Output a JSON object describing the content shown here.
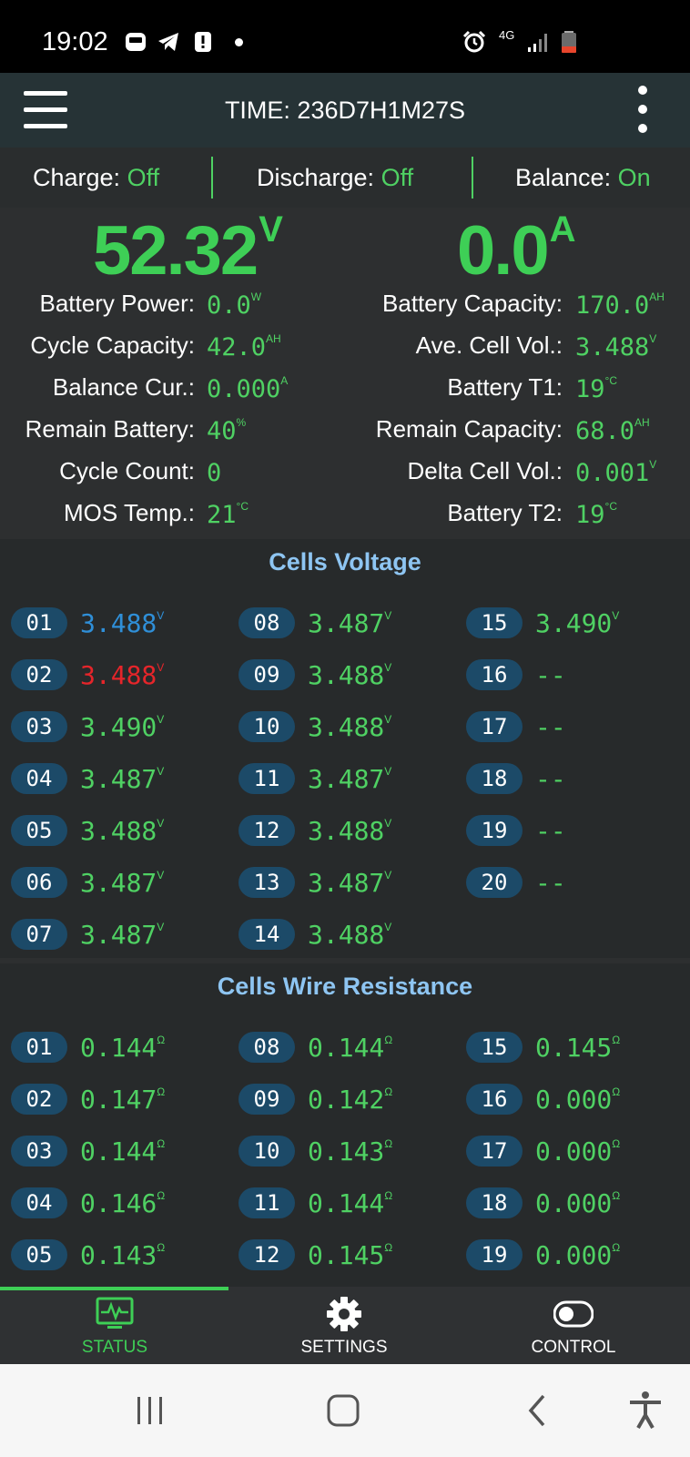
{
  "status_bar": {
    "time": "19:02",
    "network": "4G",
    "icons": [
      "adblocker-icon",
      "telegram-icon",
      "alert-icon",
      "alarm-icon",
      "signal-icon",
      "battery-icon"
    ]
  },
  "app_bar": {
    "title": "TIME: 236D7H1M27S"
  },
  "switches": {
    "charge_label": "Charge: ",
    "charge_value": "Off",
    "discharge_label": "Discharge: ",
    "discharge_value": "Off",
    "balance_label": "Balance: ",
    "balance_value": "On"
  },
  "main": {
    "voltage": "52.32",
    "voltage_unit": "V",
    "current": "0.0",
    "current_unit": "A"
  },
  "info_left": [
    {
      "label": "Battery Power:",
      "value": "0.0",
      "unit": "W"
    },
    {
      "label": "Cycle Capacity:",
      "value": "42.0",
      "unit": "AH"
    },
    {
      "label": "Balance Cur.:",
      "value": "0.000",
      "unit": "A"
    },
    {
      "label": "Remain Battery:",
      "value": "40",
      "unit": "%"
    },
    {
      "label": "Cycle Count:",
      "value": "0",
      "unit": ""
    },
    {
      "label": "MOS Temp.:",
      "value": "21",
      "unit": "°C"
    }
  ],
  "info_right": [
    {
      "label": "Battery Capacity:",
      "value": "170.0",
      "unit": "AH"
    },
    {
      "label": "Ave. Cell Vol.:",
      "value": "3.488",
      "unit": "V"
    },
    {
      "label": "Battery T1:",
      "value": "19",
      "unit": "°C"
    },
    {
      "label": "Remain Capacity:",
      "value": "68.0",
      "unit": "AH"
    },
    {
      "label": "Delta Cell Vol.:",
      "value": "0.001",
      "unit": "V"
    },
    {
      "label": "Battery T2:",
      "value": "19",
      "unit": "°C"
    }
  ],
  "cells_voltage": {
    "title": "Cells Voltage",
    "cells": [
      {
        "id": "01",
        "value": "3.488",
        "unit": "V",
        "state": "min"
      },
      {
        "id": "02",
        "value": "3.488",
        "unit": "V",
        "state": "max"
      },
      {
        "id": "03",
        "value": "3.490",
        "unit": "V",
        "state": "normal"
      },
      {
        "id": "04",
        "value": "3.487",
        "unit": "V",
        "state": "normal"
      },
      {
        "id": "05",
        "value": "3.488",
        "unit": "V",
        "state": "normal"
      },
      {
        "id": "06",
        "value": "3.487",
        "unit": "V",
        "state": "normal"
      },
      {
        "id": "07",
        "value": "3.487",
        "unit": "V",
        "state": "normal"
      },
      {
        "id": "08",
        "value": "3.487",
        "unit": "V",
        "state": "normal"
      },
      {
        "id": "09",
        "value": "3.488",
        "unit": "V",
        "state": "normal"
      },
      {
        "id": "10",
        "value": "3.488",
        "unit": "V",
        "state": "normal"
      },
      {
        "id": "11",
        "value": "3.487",
        "unit": "V",
        "state": "normal"
      },
      {
        "id": "12",
        "value": "3.488",
        "unit": "V",
        "state": "normal"
      },
      {
        "id": "13",
        "value": "3.487",
        "unit": "V",
        "state": "normal"
      },
      {
        "id": "14",
        "value": "3.488",
        "unit": "V",
        "state": "normal"
      },
      {
        "id": "15",
        "value": "3.490",
        "unit": "V",
        "state": "normal"
      },
      {
        "id": "16",
        "value": "--",
        "unit": "",
        "state": "normal"
      },
      {
        "id": "17",
        "value": "--",
        "unit": "",
        "state": "normal"
      },
      {
        "id": "18",
        "value": "--",
        "unit": "",
        "state": "normal"
      },
      {
        "id": "19",
        "value": "--",
        "unit": "",
        "state": "normal"
      },
      {
        "id": "20",
        "value": "--",
        "unit": "",
        "state": "normal"
      }
    ]
  },
  "cells_resistance": {
    "title": "Cells Wire Resistance",
    "cells": [
      {
        "id": "01",
        "value": "0.144",
        "unit": "Ω"
      },
      {
        "id": "02",
        "value": "0.147",
        "unit": "Ω"
      },
      {
        "id": "03",
        "value": "0.144",
        "unit": "Ω"
      },
      {
        "id": "04",
        "value": "0.146",
        "unit": "Ω"
      },
      {
        "id": "05",
        "value": "0.143",
        "unit": "Ω"
      },
      {
        "id": "08",
        "value": "0.144",
        "unit": "Ω"
      },
      {
        "id": "09",
        "value": "0.142",
        "unit": "Ω"
      },
      {
        "id": "10",
        "value": "0.143",
        "unit": "Ω"
      },
      {
        "id": "11",
        "value": "0.144",
        "unit": "Ω"
      },
      {
        "id": "12",
        "value": "0.145",
        "unit": "Ω"
      },
      {
        "id": "15",
        "value": "0.145",
        "unit": "Ω"
      },
      {
        "id": "16",
        "value": "0.000",
        "unit": "Ω"
      },
      {
        "id": "17",
        "value": "0.000",
        "unit": "Ω"
      },
      {
        "id": "18",
        "value": "0.000",
        "unit": "Ω"
      },
      {
        "id": "19",
        "value": "0.000",
        "unit": "Ω"
      }
    ]
  },
  "bottom_nav": {
    "items": [
      {
        "label": "STATUS",
        "icon": "monitor-pulse-icon",
        "active": true
      },
      {
        "label": "SETTINGS",
        "icon": "gear-icon",
        "active": false
      },
      {
        "label": "CONTROL",
        "icon": "toggle-icon",
        "active": false
      }
    ]
  },
  "system_nav": {
    "icons": [
      "recent-apps-icon",
      "home-icon",
      "back-icon",
      "accessibility-icon"
    ]
  },
  "colors": {
    "value_green": "#4fd163",
    "min_cell_blue": "#2f8fd8",
    "max_cell_red": "#e5252a",
    "section_title": "#8ec5f2",
    "badge": "#1c4a68",
    "app_bar": "#263336"
  }
}
